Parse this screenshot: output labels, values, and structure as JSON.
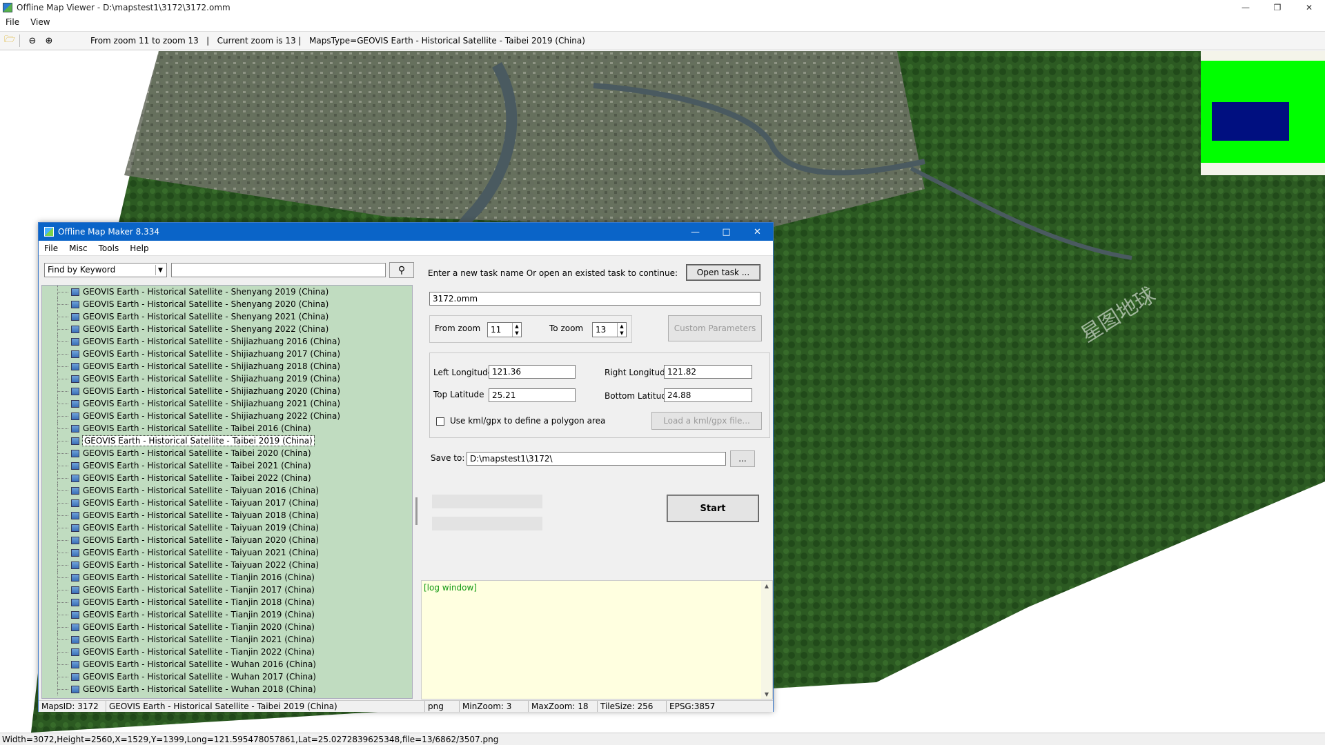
{
  "viewer": {
    "title": "Offline Map Viewer - D:\\mapstest1\\3172\\3172.omm",
    "menu": [
      "File",
      "View"
    ],
    "toolbar_info": "From zoom 11 to zoom 13   |   Current zoom is 13 |   MapsType=GEOVIS Earth - Historical Satellite - Taibei 2019 (China)",
    "status": "Width=3072,Height=2560,X=1529,Y=1399,Long=121.595478057861,Lat=25.0272839625348,file=13/6862/3507.png",
    "watermark": "星图地球"
  },
  "dialog": {
    "title": "Offline Map Maker 8.334",
    "menu": [
      "File",
      "Misc",
      "Tools",
      "Help"
    ],
    "find_mode": "Find by Keyword",
    "search_value": "",
    "tree_items": [
      "GEOVIS Earth - Historical Satellite - Shenyang 2019 (China)",
      "GEOVIS Earth - Historical Satellite - Shenyang 2020 (China)",
      "GEOVIS Earth - Historical Satellite - Shenyang 2021 (China)",
      "GEOVIS Earth - Historical Satellite - Shenyang 2022 (China)",
      "GEOVIS Earth - Historical Satellite - Shijiazhuang 2016 (China)",
      "GEOVIS Earth - Historical Satellite - Shijiazhuang 2017 (China)",
      "GEOVIS Earth - Historical Satellite - Shijiazhuang 2018 (China)",
      "GEOVIS Earth - Historical Satellite - Shijiazhuang 2019 (China)",
      "GEOVIS Earth - Historical Satellite - Shijiazhuang 2020 (China)",
      "GEOVIS Earth - Historical Satellite - Shijiazhuang 2021 (China)",
      "GEOVIS Earth - Historical Satellite - Shijiazhuang 2022 (China)",
      "GEOVIS Earth - Historical Satellite - Taibei 2016 (China)",
      "GEOVIS Earth - Historical Satellite - Taibei 2019 (China)",
      "GEOVIS Earth - Historical Satellite - Taibei 2020 (China)",
      "GEOVIS Earth - Historical Satellite - Taibei 2021 (China)",
      "GEOVIS Earth - Historical Satellite - Taibei 2022 (China)",
      "GEOVIS Earth - Historical Satellite - Taiyuan 2016 (China)",
      "GEOVIS Earth - Historical Satellite - Taiyuan 2017 (China)",
      "GEOVIS Earth - Historical Satellite - Taiyuan 2018 (China)",
      "GEOVIS Earth - Historical Satellite - Taiyuan 2019 (China)",
      "GEOVIS Earth - Historical Satellite - Taiyuan 2020 (China)",
      "GEOVIS Earth - Historical Satellite - Taiyuan 2021 (China)",
      "GEOVIS Earth - Historical Satellite - Taiyuan 2022 (China)",
      "GEOVIS Earth - Historical Satellite - Tianjin 2016 (China)",
      "GEOVIS Earth - Historical Satellite - Tianjin 2017 (China)",
      "GEOVIS Earth - Historical Satellite - Tianjin 2018 (China)",
      "GEOVIS Earth - Historical Satellite - Tianjin 2019 (China)",
      "GEOVIS Earth - Historical Satellite - Tianjin 2020 (China)",
      "GEOVIS Earth - Historical Satellite - Tianjin 2021 (China)",
      "GEOVIS Earth - Historical Satellite - Tianjin 2022 (China)",
      "GEOVIS Earth - Historical Satellite - Wuhan 2016 (China)",
      "GEOVIS Earth - Historical Satellite - Wuhan 2017 (China)",
      "GEOVIS Earth - Historical Satellite - Wuhan 2018 (China)"
    ],
    "selected_index": 12,
    "task_prompt": "Enter a new task name Or open an existed task to continue:",
    "open_task_label": "Open task ...",
    "task_name": "3172.omm",
    "from_zoom_label": "From zoom",
    "from_zoom": "11",
    "to_zoom_label": "To zoom",
    "to_zoom": "13",
    "custom_params_label": "Custom Parameters",
    "left_lon_label": "Left Longitude",
    "left_lon": "121.36",
    "right_lon_label": "Right Longitude",
    "right_lon": "121.82",
    "top_lat_label": "Top Latitude",
    "top_lat": "25.21",
    "bottom_lat_label": "Bottom Latitude",
    "bottom_lat": "24.88",
    "kml_label": "Use kml/gpx to define a polygon area",
    "load_kml_label": "Load a kml/gpx file...",
    "save_to_label": "Save to:",
    "save_to": "D:\\mapstest1\\3172\\",
    "browse_label": "...",
    "start_label": "Start",
    "log_text": "[log window]",
    "status": {
      "maps_id": "MapsID: 3172",
      "maps_name": "GEOVIS Earth - Historical Satellite - Taibei 2019 (China)",
      "format": "png",
      "min_zoom": "MinZoom: 3",
      "max_zoom": "MaxZoom: 18",
      "tile_size": "TileSize: 256",
      "epsg": "EPSG:3857"
    }
  },
  "colors": {
    "tree_bg": "#c0dcc0",
    "log_bg": "#ffffe0",
    "dialog_title": "#0a64c8",
    "minimap_green": "#00ff00",
    "minimap_blue": "#000f80"
  }
}
